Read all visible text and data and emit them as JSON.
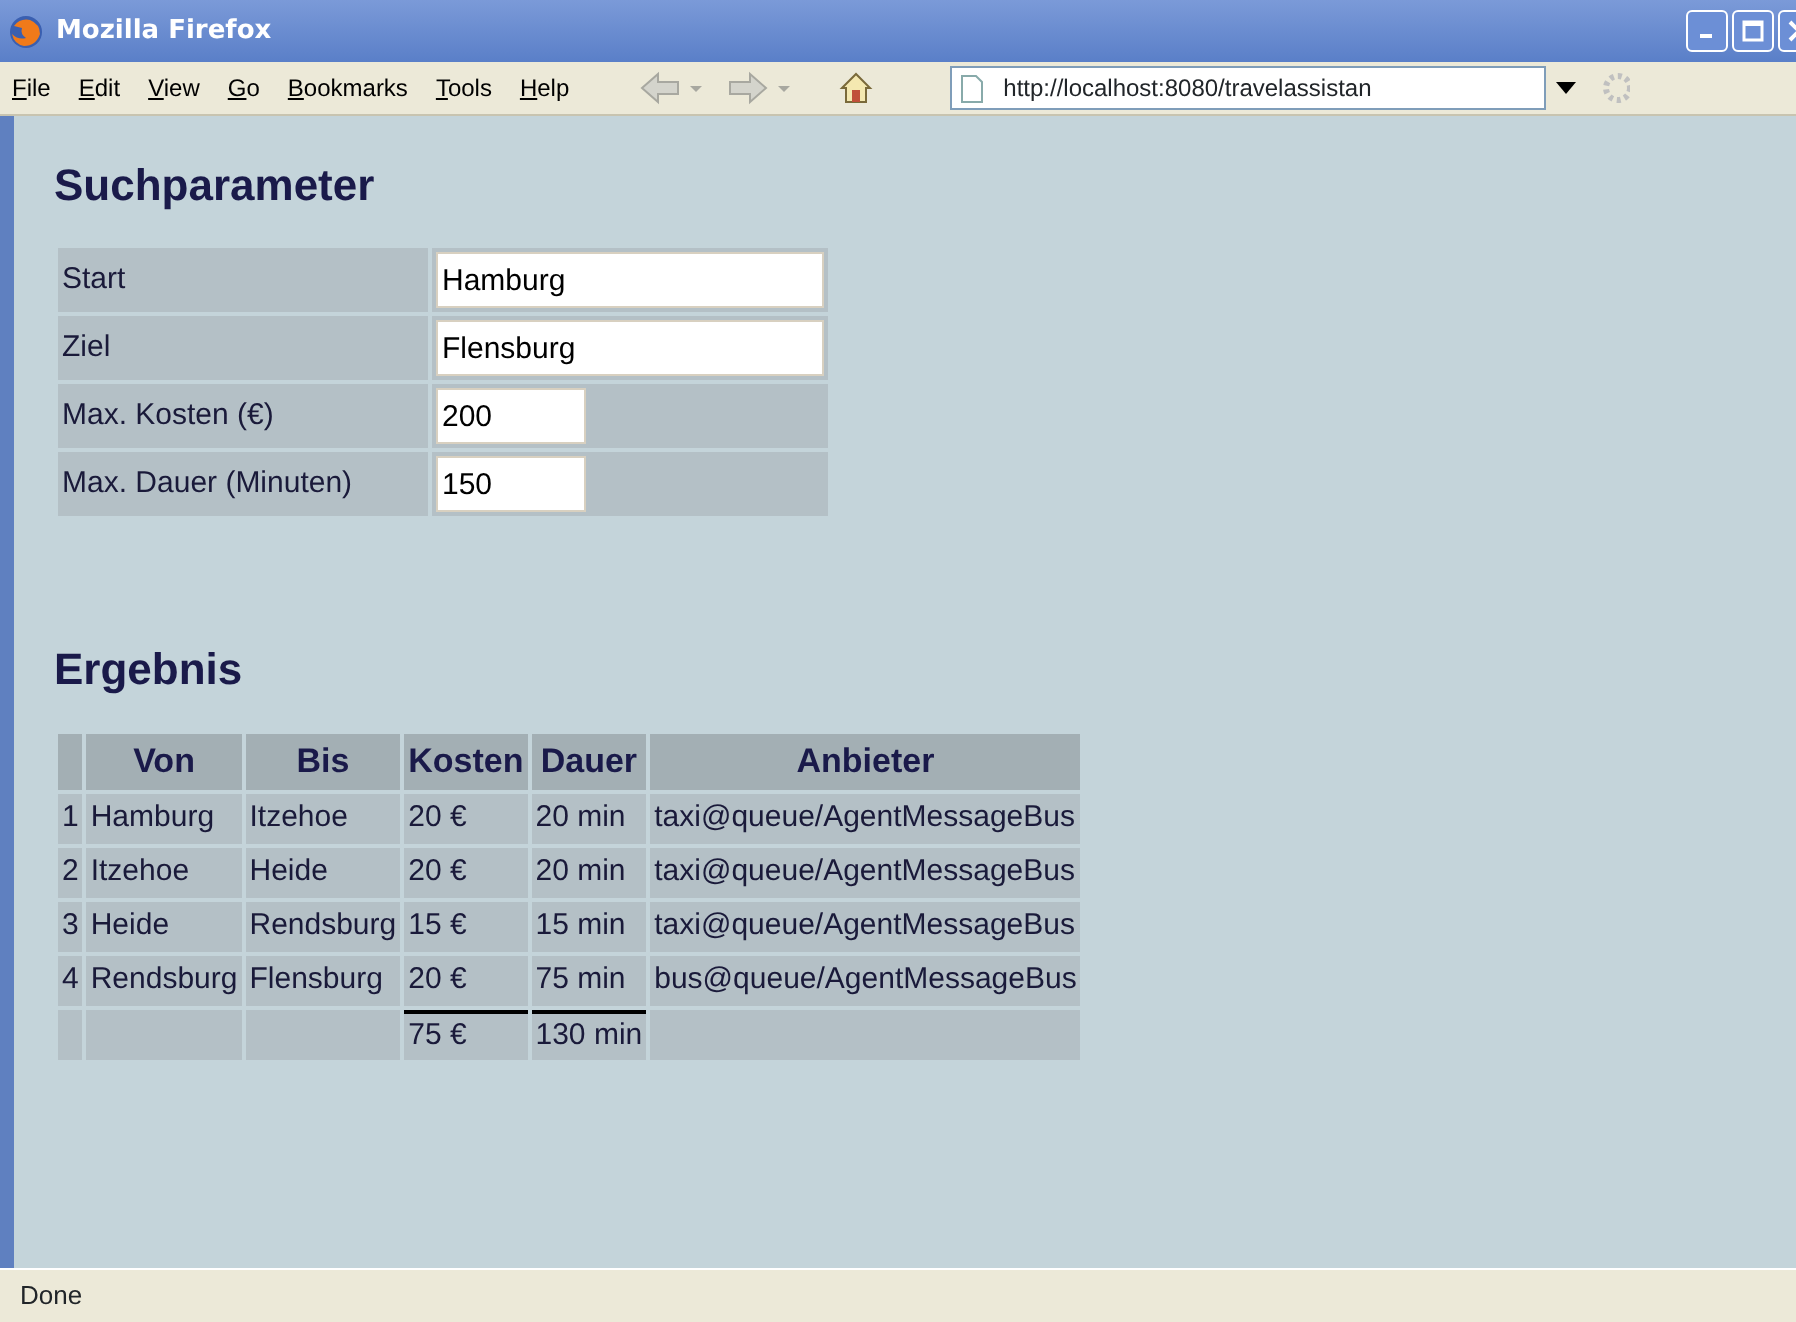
{
  "window": {
    "title": "Mozilla Firefox"
  },
  "menu": [
    "File",
    "Edit",
    "View",
    "Go",
    "Bookmarks",
    "Tools",
    "Help"
  ],
  "toolbar": {
    "back_disabled": true,
    "forward_disabled": true,
    "url": "http://localhost:8080/travelassistan"
  },
  "search": {
    "heading": "Suchparameter",
    "fields": [
      {
        "label": "Start",
        "value": "Hamburg",
        "kind": "wide"
      },
      {
        "label": "Ziel",
        "value": "Flensburg",
        "kind": "wide"
      },
      {
        "label": "Max. Kosten (€)",
        "value": "200",
        "kind": "narrow"
      },
      {
        "label": "Max. Dauer (Minuten)",
        "value": "150",
        "kind": "narrow"
      }
    ]
  },
  "result": {
    "heading": "Ergebnis",
    "columns": [
      "Von",
      "Bis",
      "Kosten",
      "Dauer",
      "Anbieter"
    ],
    "rows": [
      {
        "index": "1",
        "von": "Hamburg",
        "bis": "Itzehoe",
        "kosten": "20 €",
        "dauer": "20 min",
        "anbieter": "taxi@queue/AgentMessageBus"
      },
      {
        "index": "2",
        "von": "Itzehoe",
        "bis": "Heide",
        "kosten": "20 €",
        "dauer": "20 min",
        "anbieter": "taxi@queue/AgentMessageBus"
      },
      {
        "index": "3",
        "von": "Heide",
        "bis": "Rendsburg",
        "kosten": "15 €",
        "dauer": "15 min",
        "anbieter": "taxi@queue/AgentMessageBus"
      },
      {
        "index": "4",
        "von": "Rendsburg",
        "bis": "Flensburg",
        "kosten": "20 €",
        "dauer": "75 min",
        "anbieter": "bus@queue/AgentMessageBus"
      }
    ],
    "total": {
      "kosten": "75 €",
      "dauer": "130 min"
    }
  },
  "status_bar": "Done"
}
